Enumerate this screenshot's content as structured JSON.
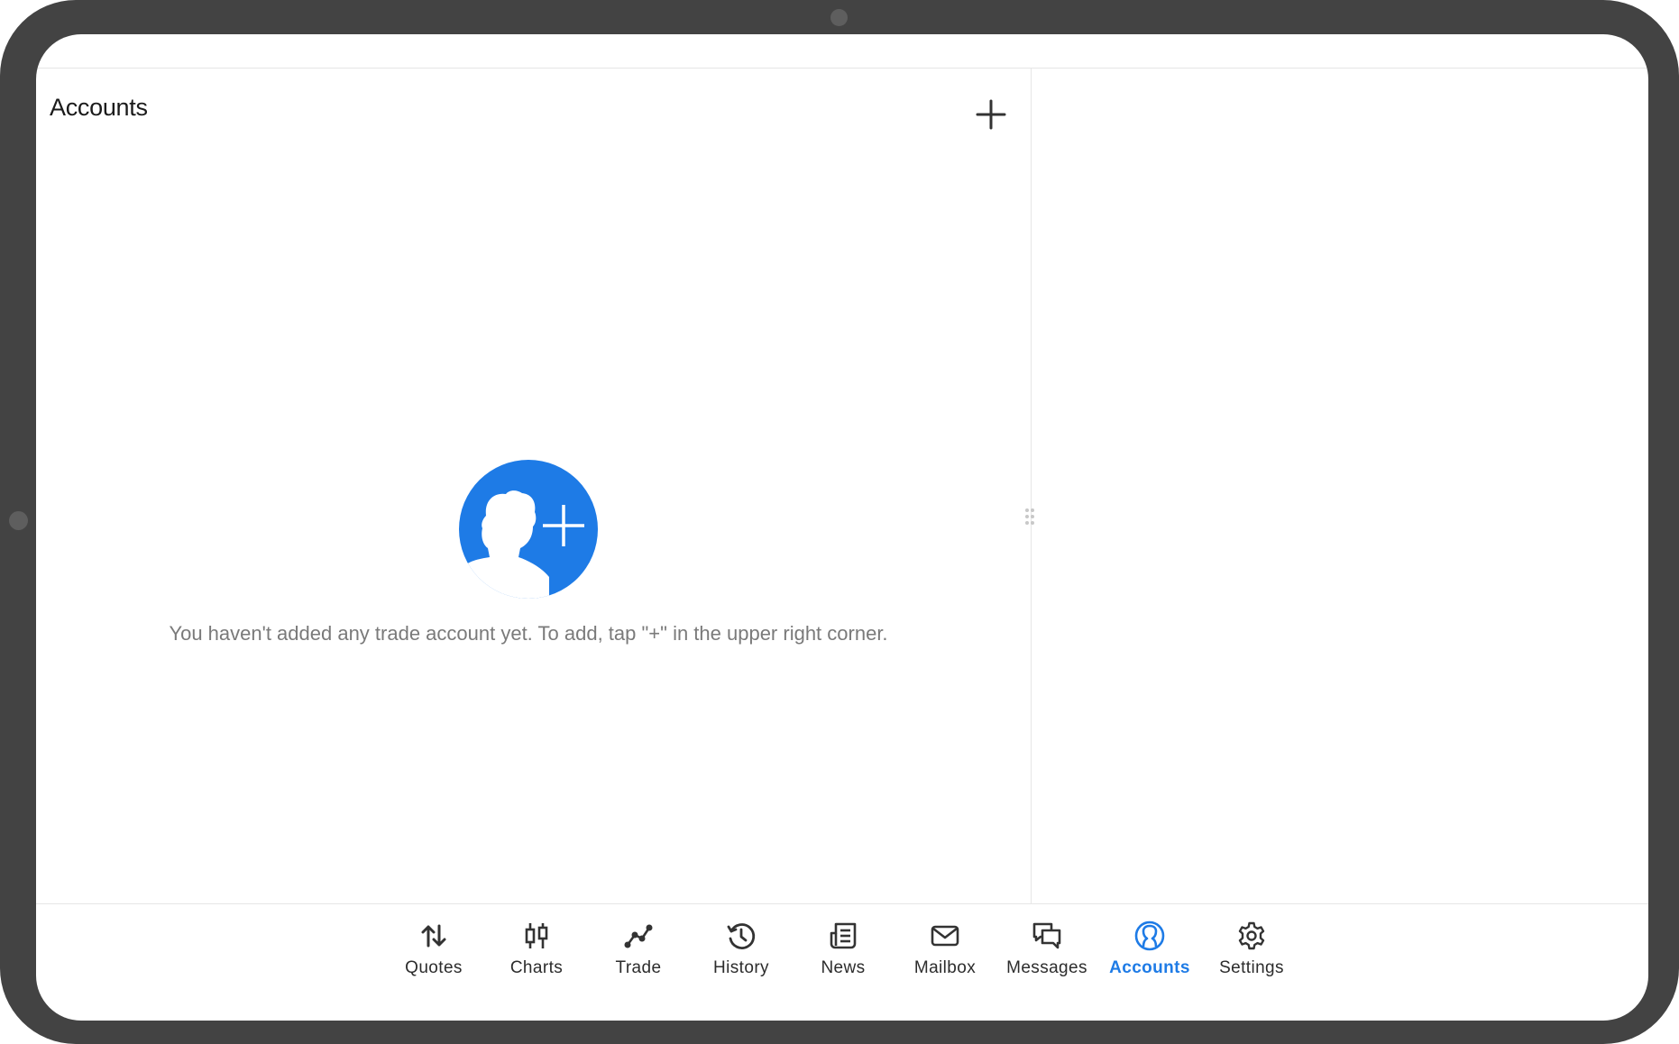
{
  "accounts_pane": {
    "title": "Accounts",
    "empty_message": "You haven't added any trade account yet. To add, tap \"+\" in the upper right corner."
  },
  "colors": {
    "accent": "#1e7be6",
    "device_frame": "#434343",
    "text_primary": "#1b1b1b",
    "text_secondary": "#7a7a7a"
  },
  "bottom_nav": {
    "active": "Accounts",
    "items": [
      {
        "label": "Quotes",
        "icon": "arrows-up-down-icon"
      },
      {
        "label": "Charts",
        "icon": "candlestick-icon"
      },
      {
        "label": "Trade",
        "icon": "trend-line-icon"
      },
      {
        "label": "History",
        "icon": "history-clock-icon"
      },
      {
        "label": "News",
        "icon": "newspaper-icon"
      },
      {
        "label": "Mailbox",
        "icon": "envelope-icon"
      },
      {
        "label": "Messages",
        "icon": "chat-bubbles-icon"
      },
      {
        "label": "Accounts",
        "icon": "user-circle-icon"
      },
      {
        "label": "Settings",
        "icon": "gear-icon"
      }
    ]
  }
}
